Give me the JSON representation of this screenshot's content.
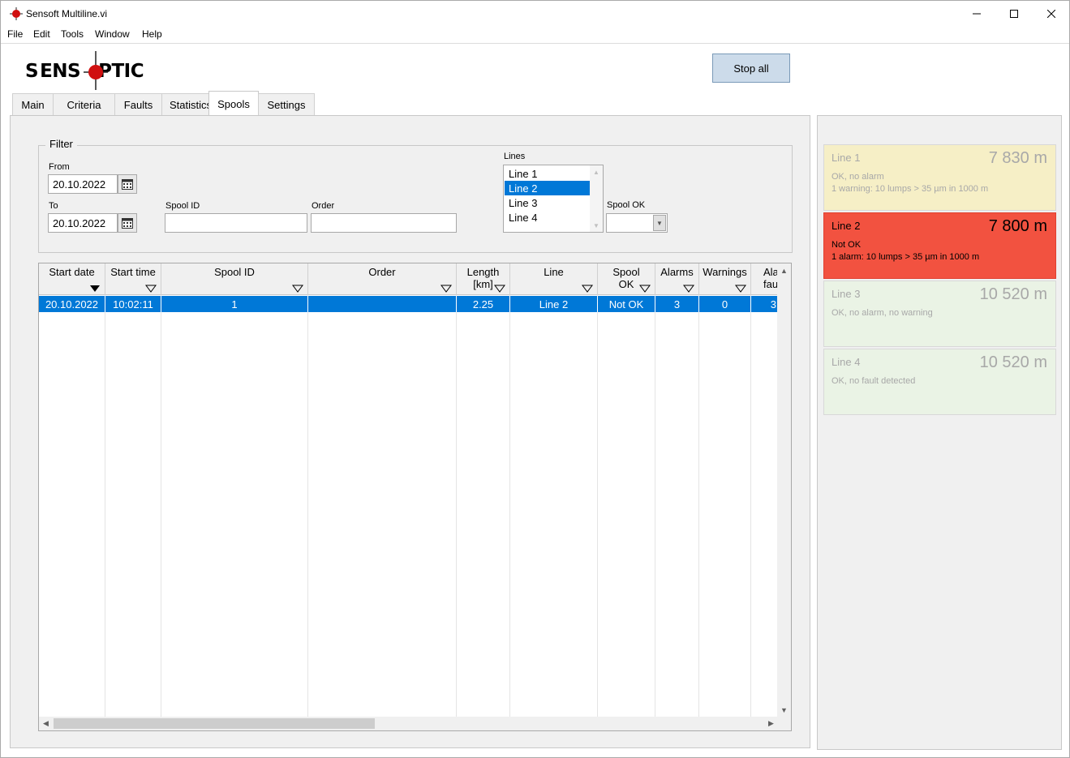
{
  "window": {
    "title": "Sensoft Multiline.vi"
  },
  "menu": [
    "File",
    "Edit",
    "Tools",
    "Window",
    "Help"
  ],
  "logo": {
    "text": "SENSOPTIC"
  },
  "stop_all_label": "Stop all",
  "tabs": [
    {
      "label": "Main"
    },
    {
      "label": "Criteria"
    },
    {
      "label": "Faults"
    },
    {
      "label": "Statistics"
    },
    {
      "label": "Spools",
      "active": true
    },
    {
      "label": "Settings"
    }
  ],
  "filter": {
    "title": "Filter",
    "from_label": "From",
    "from_value": "20.10.2022",
    "to_label": "To",
    "to_value": "20.10.2022",
    "spool_id_label": "Spool ID",
    "spool_id_value": "",
    "order_label": "Order",
    "order_value": "",
    "lines_label": "Lines",
    "lines": [
      "Line 1",
      "Line 2",
      "Line 3",
      "Line 4"
    ],
    "lines_selected": "Line 2",
    "spool_ok_label": "Spool OK",
    "spool_ok_value": ""
  },
  "table": {
    "columns": [
      {
        "label": "Start date",
        "sorted": "desc"
      },
      {
        "label": "Start time"
      },
      {
        "label": "Spool ID"
      },
      {
        "label": "Order"
      },
      {
        "label": "Length",
        "label2": "[km]"
      },
      {
        "label": "Line"
      },
      {
        "label": "Spool",
        "label2": "OK"
      },
      {
        "label": "Alarms"
      },
      {
        "label": "Warnings"
      },
      {
        "label": "Ala",
        "label2": "fau"
      }
    ],
    "rows": [
      [
        "20.10.2022",
        "10:02:11",
        "1",
        "",
        "2.25",
        "Line 2",
        "Not OK",
        "3",
        "0",
        "3"
      ]
    ]
  },
  "status": [
    {
      "name": "Line 1",
      "length": "7 830 m",
      "line1": "OK, no alarm",
      "line2": "1 warning: 10 lumps > 35 µm in 1000 m",
      "state": "warn"
    },
    {
      "name": "Line 2",
      "length": "7 800 m",
      "line1": "Not OK",
      "line2": "1 alarm: 10 lumps > 35 µm in 1000 m",
      "state": "alarm"
    },
    {
      "name": "Line 3",
      "length": "10 520 m",
      "line1": "OK, no alarm, no warning",
      "line2": "",
      "state": "ok"
    },
    {
      "name": "Line 4",
      "length": "10 520 m",
      "line1": "OK, no fault detected",
      "line2": "",
      "state": "ok"
    }
  ],
  "colors": {
    "selection": "#0078d7",
    "alarm": "#f25240",
    "warning": "#f6efc6",
    "ok": "#eaf3e5",
    "stop_button": "#ccdbea"
  }
}
